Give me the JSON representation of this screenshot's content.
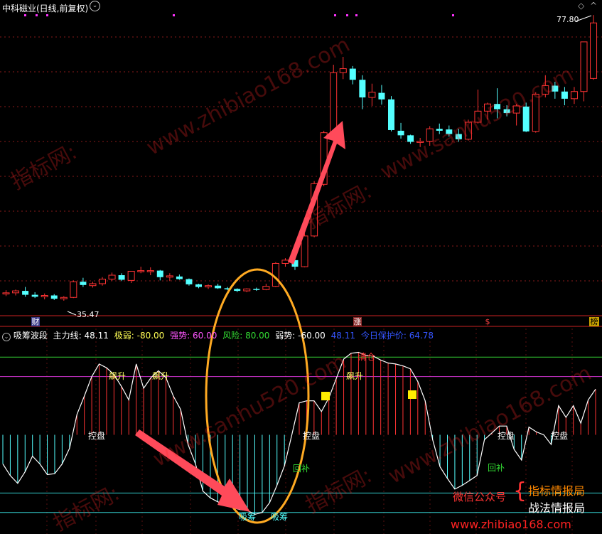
{
  "top_panel": {
    "title": "中科磁业(日线,前复权)",
    "price_high_label": "77.80",
    "price_low_label": "35.47",
    "bottom_tags": [
      "财",
      "涨",
      "$",
      "榜"
    ]
  },
  "indicator_panel": {
    "name": "吸筹波段",
    "main_line_label": "主力线:",
    "main_line_value": "48.11",
    "extreme_weak_label": "极弱:",
    "extreme_weak_value": "-80.00",
    "strong_label": "强势:",
    "strong_value": "60.00",
    "risk_label": "风险:",
    "risk_value": "80.00",
    "weak_label": "弱势:",
    "weak_value": "-60.00",
    "extra_value": "48.11",
    "protect_label": "今日保护价:",
    "protect_value": "64.78",
    "signals": {
      "piaosheng": "飙升",
      "kongpan": "控盘",
      "xichou": "吸筹",
      "huibu": "回补",
      "qingcang": "清仓"
    }
  },
  "promo": {
    "wechat": "微信公众号",
    "line1": "指标情报局",
    "line2": "战法情报局",
    "site": "www.zhibiao168.com"
  },
  "watermarks": [
    "www.zhibiao168.com",
    "www.sanhu520.com",
    "指标网:"
  ],
  "colors": {
    "up": "#ff3333",
    "down": "#54ffff",
    "risk_line": "#33cc33",
    "strong_line": "#cc33cc",
    "weak_line": "#33cccc",
    "extreme_line": "#33cccc",
    "ellipse": "#ffaa22",
    "arrow": "#ff4a5a"
  },
  "chart_data": [
    {
      "type": "candlestick",
      "title": "中科磁业(日线,前复权)",
      "y_labels": {
        "high": 77.8,
        "low": 35.47
      },
      "ohlc": [
        [
          36.4,
          36.9,
          36.0,
          36.5
        ],
        [
          36.5,
          37.0,
          36.1,
          36.8
        ],
        [
          36.8,
          37.4,
          35.9,
          36.2
        ],
        [
          36.2,
          36.6,
          35.7,
          35.9
        ],
        [
          35.9,
          36.4,
          35.5,
          36.1
        ],
        [
          36.1,
          36.3,
          35.4,
          35.6
        ],
        [
          35.6,
          36.0,
          35.3,
          35.8
        ],
        [
          35.8,
          38.4,
          35.7,
          38.2
        ],
        [
          38.2,
          38.8,
          37.4,
          37.7
        ],
        [
          37.6,
          38.2,
          37.3,
          37.9
        ],
        [
          37.9,
          38.9,
          37.6,
          38.6
        ],
        [
          38.6,
          39.6,
          38.3,
          39.2
        ],
        [
          39.2,
          39.5,
          38.3,
          38.5
        ],
        [
          38.4,
          39.8,
          38.0,
          39.8
        ],
        [
          39.8,
          40.5,
          39.5,
          39.9
        ],
        [
          39.9,
          40.4,
          39.2,
          39.9
        ],
        [
          39.9,
          40.0,
          38.4,
          38.9
        ],
        [
          38.9,
          39.5,
          38.3,
          39.1
        ],
        [
          39.0,
          39.3,
          38.5,
          38.6
        ],
        [
          38.6,
          38.7,
          37.6,
          37.8
        ],
        [
          37.8,
          37.9,
          37.2,
          37.4
        ],
        [
          37.4,
          37.8,
          37.1,
          37.6
        ],
        [
          37.6,
          37.9,
          37.1,
          37.2
        ],
        [
          37.2,
          37.4,
          36.9,
          37.1
        ],
        [
          37.1,
          37.2,
          36.6,
          36.8
        ],
        [
          36.8,
          37.2,
          36.6,
          37.1
        ],
        [
          37.1,
          37.3,
          36.8,
          37.0
        ],
        [
          37.0,
          37.9,
          36.9,
          37.5
        ],
        [
          37.5,
          41.2,
          37.4,
          41.0
        ],
        [
          41.0,
          41.8,
          40.5,
          41.5
        ],
        [
          41.5,
          41.9,
          40.0,
          40.5
        ],
        [
          40.5,
          45.6,
          40.4,
          45.2
        ],
        [
          45.2,
          53.6,
          45.0,
          53.2
        ],
        [
          53.1,
          61.3,
          52.8,
          61.0
        ],
        [
          61.0,
          71.4,
          60.9,
          70.2
        ],
        [
          70.2,
          72.6,
          69.2,
          70.8
        ],
        [
          70.8,
          71.2,
          68.4,
          69.1
        ],
        [
          69.1,
          69.8,
          64.6,
          66.4
        ],
        [
          66.4,
          68.5,
          65.1,
          67.2
        ],
        [
          67.1,
          68.3,
          65.3,
          66.1
        ],
        [
          66.1,
          66.6,
          61.2,
          61.4
        ],
        [
          61.3,
          62.5,
          60.1,
          60.6
        ],
        [
          60.6,
          60.7,
          59.3,
          59.6
        ],
        [
          59.5,
          60.2,
          58.8,
          59.7
        ],
        [
          59.7,
          62.0,
          59.0,
          61.6
        ],
        [
          61.6,
          62.4,
          60.8,
          61.3
        ],
        [
          61.5,
          62.1,
          60.4,
          60.8
        ],
        [
          60.8,
          61.6,
          59.6,
          60.0
        ],
        [
          60.0,
          63.0,
          59.8,
          62.6
        ],
        [
          62.6,
          67.6,
          62.4,
          64.3
        ],
        [
          64.3,
          65.6,
          63.0,
          65.4
        ],
        [
          65.4,
          67.8,
          63.2,
          64.6
        ],
        [
          64.6,
          65.2,
          63.5,
          64.0
        ],
        [
          64.0,
          65.4,
          62.1,
          65.1
        ],
        [
          65.0,
          65.6,
          61.1,
          61.2
        ],
        [
          61.2,
          67.2,
          61.0,
          66.9
        ],
        [
          66.9,
          69.8,
          66.4,
          68.2
        ],
        [
          68.2,
          68.8,
          66.2,
          67.3
        ],
        [
          67.3,
          68.0,
          65.2,
          66.2
        ],
        [
          66.2,
          68.0,
          65.4,
          67.3
        ],
        [
          67.3,
          69.6,
          65.8,
          74.9
        ],
        [
          69.3,
          79.0,
          69.1,
          77.8
        ]
      ]
    },
    {
      "type": "line",
      "name": "主力线",
      "y_reference_lines": {
        "risk": 80,
        "strong": 60,
        "weak": -60,
        "extreme_weak": -80
      },
      "ylim": [
        -100,
        100
      ],
      "values": [
        -30,
        -42,
        -50,
        -38,
        -22,
        -30,
        -41,
        -40,
        -30,
        -14,
        21,
        40,
        60,
        73,
        69,
        62,
        50,
        36,
        73,
        48,
        59,
        66,
        59,
        40,
        26,
        -10,
        -30,
        -58,
        -65,
        -69,
        -72,
        -75,
        -77,
        -78,
        -82,
        -80,
        -70,
        -52,
        -32,
        0,
        33,
        35,
        35,
        24,
        38,
        58,
        78,
        84,
        85,
        82,
        81,
        77,
        74,
        73,
        71,
        68,
        55,
        35,
        -5,
        -33,
        -45,
        -56,
        -52,
        -47,
        -42,
        -5,
        2,
        9,
        9,
        -15,
        -26,
        8,
        3,
        0,
        -10,
        30,
        18,
        30,
        12,
        36,
        47
      ]
    }
  ]
}
